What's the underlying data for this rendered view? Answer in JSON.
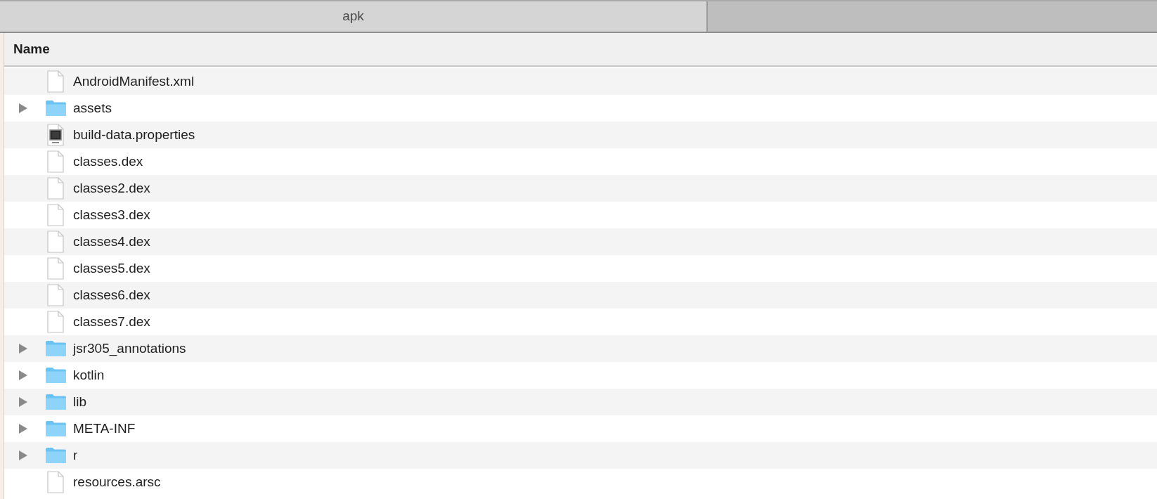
{
  "tabs": [
    {
      "label": "apk",
      "selected": true
    }
  ],
  "columns": [
    "Name"
  ],
  "rows": [
    {
      "name": "AndroidManifest.xml",
      "kind": "file"
    },
    {
      "name": "assets",
      "kind": "folder"
    },
    {
      "name": "build-data.properties",
      "kind": "java_file"
    },
    {
      "name": "classes.dex",
      "kind": "file"
    },
    {
      "name": "classes2.dex",
      "kind": "file"
    },
    {
      "name": "classes3.dex",
      "kind": "file"
    },
    {
      "name": "classes4.dex",
      "kind": "file"
    },
    {
      "name": "classes5.dex",
      "kind": "file"
    },
    {
      "name": "classes6.dex",
      "kind": "file"
    },
    {
      "name": "classes7.dex",
      "kind": "file"
    },
    {
      "name": "jsr305_annotations",
      "kind": "folder"
    },
    {
      "name": "kotlin",
      "kind": "folder"
    },
    {
      "name": "lib",
      "kind": "folder"
    },
    {
      "name": "META-INF",
      "kind": "folder"
    },
    {
      "name": "r",
      "kind": "folder"
    },
    {
      "name": "resources.arsc",
      "kind": "file"
    }
  ]
}
